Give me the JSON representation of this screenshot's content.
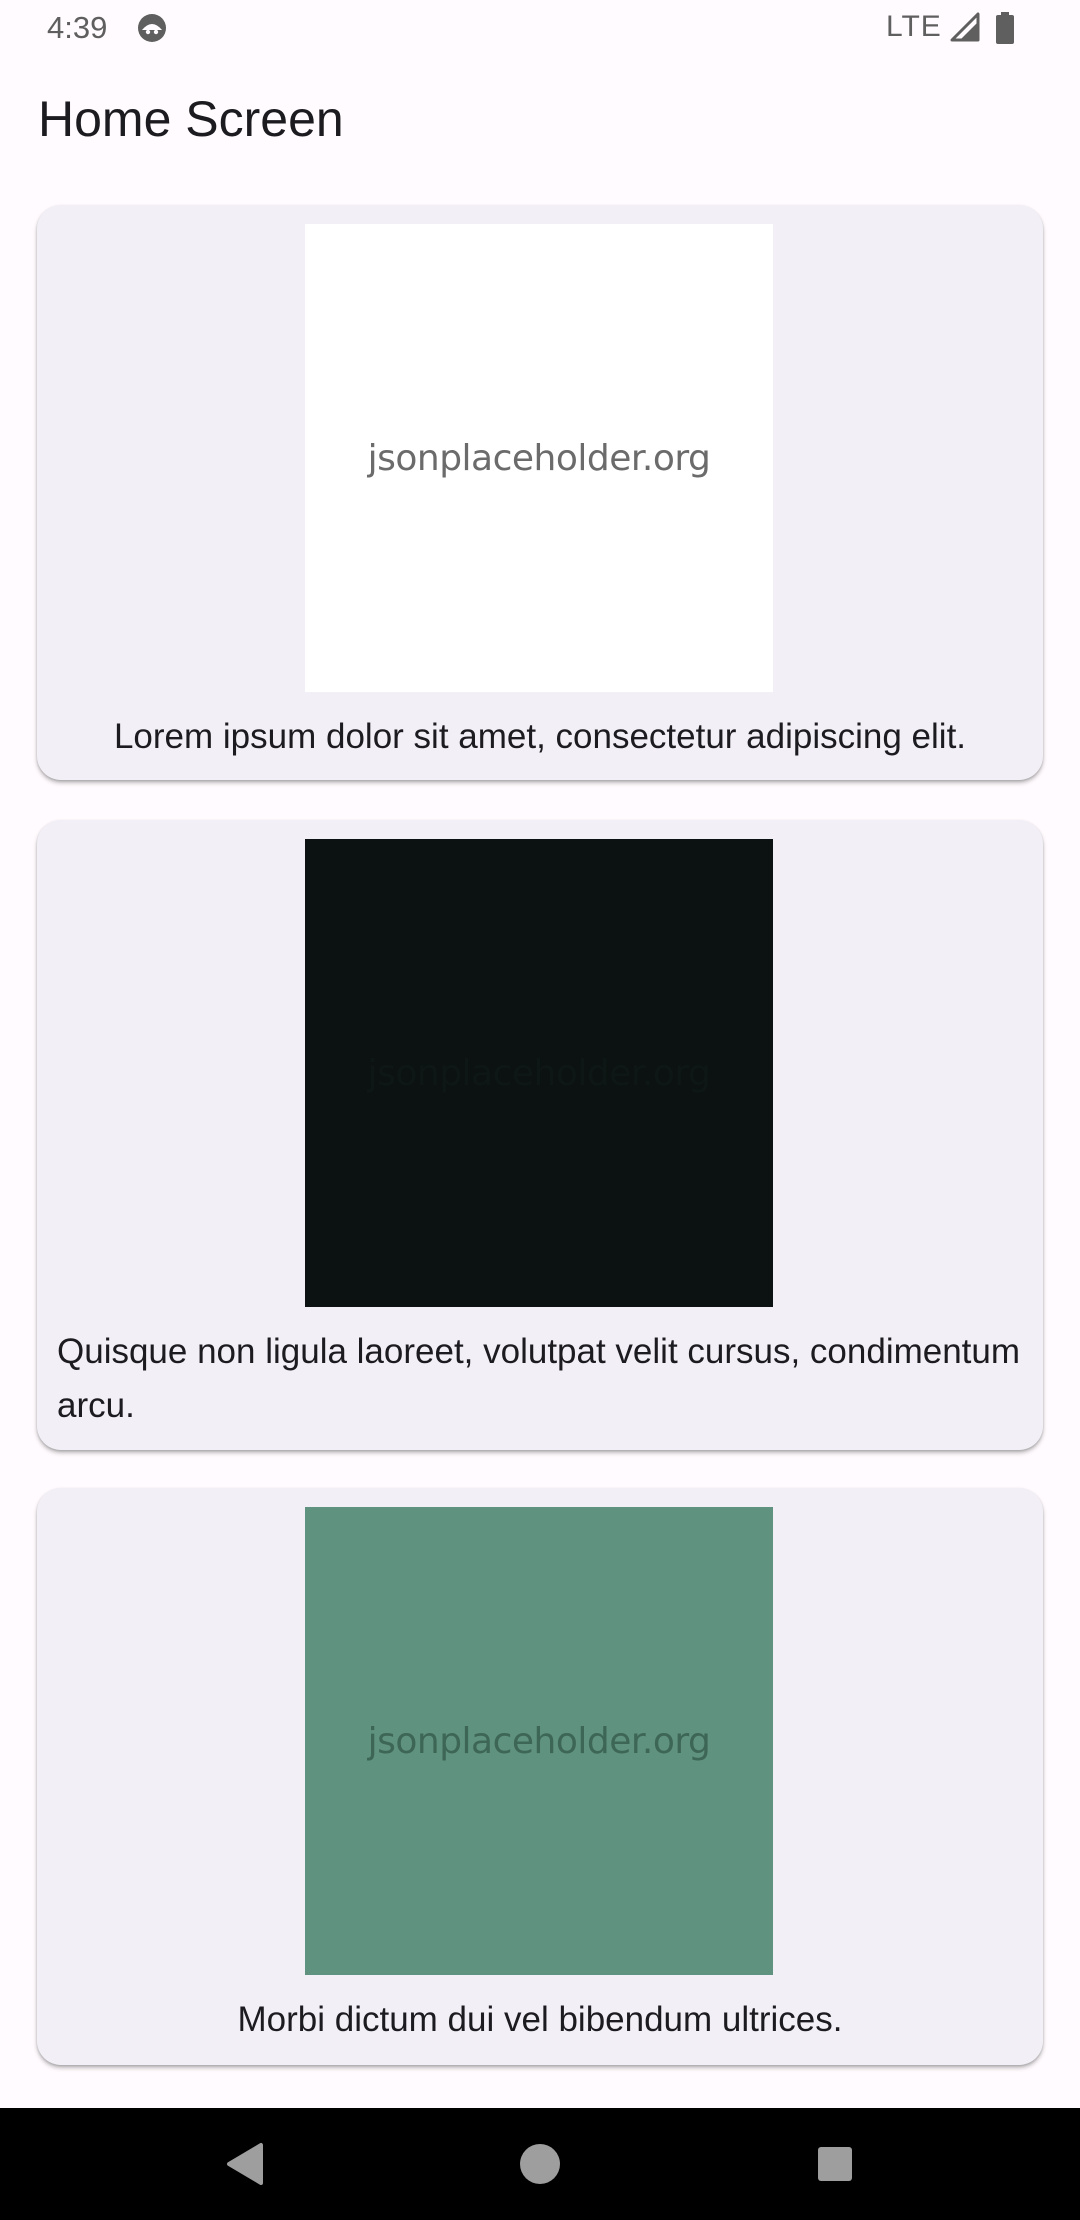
{
  "status_bar": {
    "time": "4:39",
    "network": "LTE",
    "app_icon": "android-face-icon",
    "signal_icon": "signal-icon",
    "battery_icon": "battery-icon"
  },
  "app_bar": {
    "title": "Home Screen"
  },
  "cards": [
    {
      "image_text": "jsonplaceholder.org",
      "image_bg": "#ffffff",
      "image_text_color": "#6b6b6b",
      "caption": "Lorem ipsum dolor sit amet, consectetur adipiscing elit."
    },
    {
      "image_text": "jsonplaceholder.org",
      "image_bg": "#0b1211",
      "image_text_color": "#0f1716",
      "caption": "Quisque non ligula laoreet, volutpat velit cursus, condimentum arcu."
    },
    {
      "image_text": "jsonplaceholder.org",
      "image_bg": "#5f937f",
      "image_text_color": "#3e6656",
      "caption": "Morbi dictum dui vel bibendum ultrices."
    }
  ],
  "colors": {
    "background": "#fffbfe",
    "card": "#f3eff7",
    "text": "#1c1b1f",
    "nav_bar": "#000000"
  },
  "nav_bar": {
    "back_icon": "back-triangle-icon",
    "home_icon": "home-circle-icon",
    "recents_icon": "recents-square-icon"
  }
}
